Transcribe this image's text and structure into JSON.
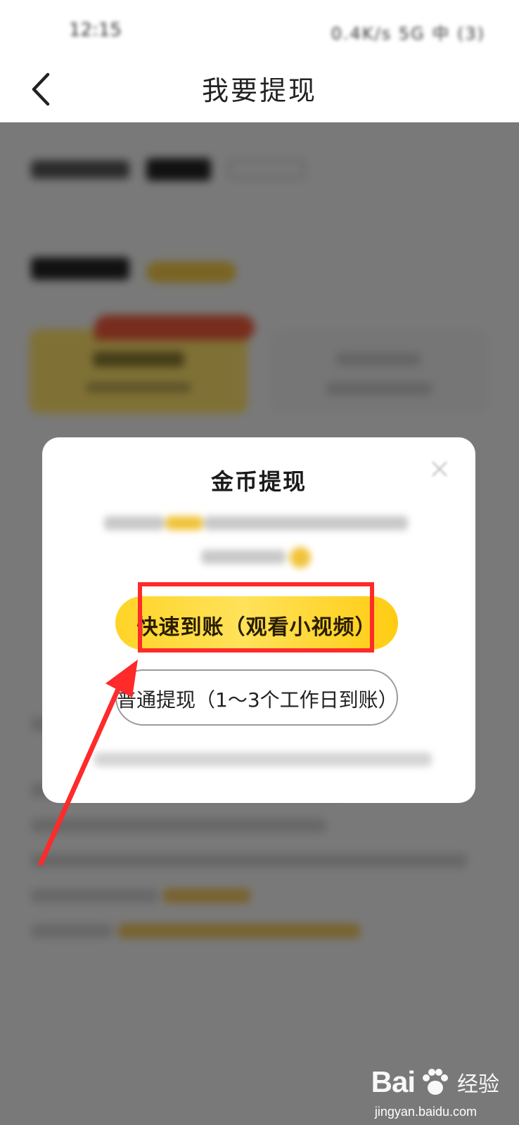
{
  "status_bar": {
    "time": "12:15",
    "indicators": "0.4K/s 5G 中 (3)"
  },
  "header": {
    "title": "我要提现",
    "back_icon": "chevron-left-icon"
  },
  "dialog": {
    "title": "金币提现",
    "close_icon": "close-icon",
    "fast_button_label": "快速到账（观看小视频）",
    "normal_button_label": "普通提现（1～3个工作日到账）"
  },
  "annotation": {
    "highlight_color": "#ff2a2a"
  },
  "colors": {
    "accent_yellow": "#ffd427",
    "overlay": "rgba(0,0,0,0.5)"
  },
  "watermark": {
    "brand_text": "Bai",
    "brand_text_2": "经验",
    "domain": "jingyan.baidu.com"
  }
}
